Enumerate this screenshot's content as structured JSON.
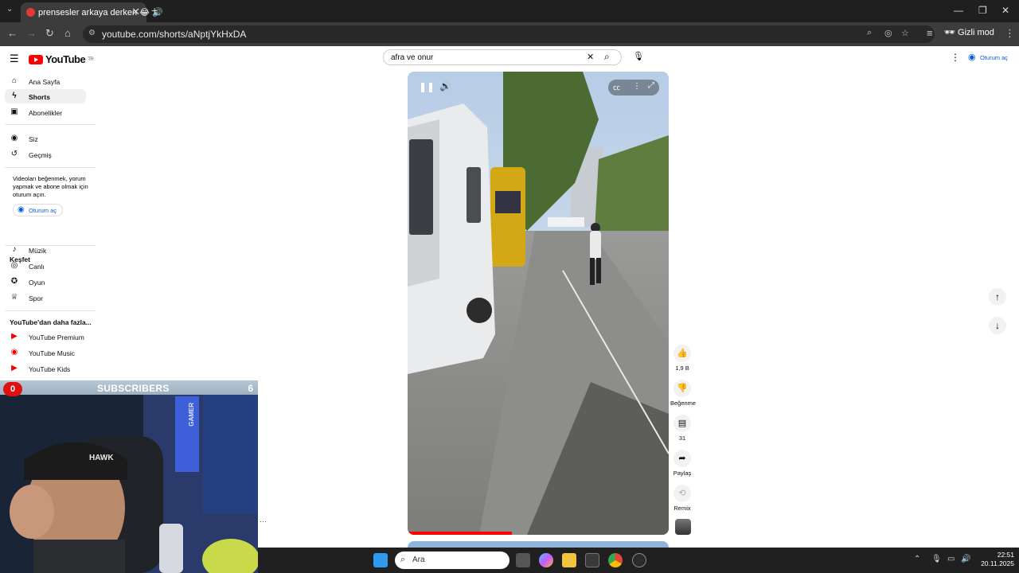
{
  "browser": {
    "tab_title": "prensesler arkaya derken 😂 🔊",
    "url": "youtube.com/shorts/aNptjYkHxDA",
    "incognito_label": "Gizli mod"
  },
  "youtube": {
    "logo_text": "YouTube",
    "region": "TR",
    "search_query": "afra ve onur",
    "top_signin": "Oturum aç",
    "sidebar": {
      "home": "Ana Sayfa",
      "shorts": "Shorts",
      "subscriptions": "Abonelikler",
      "you": "Siz",
      "history": "Geçmiş",
      "signin_note": "Videoları beğenmek, yorum yapmak ve abone olmak için oturum açın.",
      "signin_button": "Oturum aç",
      "explore_title": "Keşfet",
      "music": "Müzik",
      "live": "Canlı",
      "gaming": "Oyun",
      "sports": "Spor",
      "more_title": "YouTube'dan daha fazla...",
      "premium": "YouTube Premium",
      "ytmusic": "YouTube Music",
      "kids": "YouTube Kids"
    },
    "actions": {
      "likes": "1,9 B",
      "dislike": "Beğenme",
      "comments": "31",
      "share": "Paylaş",
      "remix": "Remix"
    },
    "progress": 0.4
  },
  "overlay": {
    "subscribers_label": "SUBSCRIBERS",
    "subscribers_left": "0",
    "subscribers_right": "6",
    "cap_text": "HAWK",
    "wall_text": "GAMER"
  },
  "taskbar": {
    "search_placeholder": "Ara",
    "time": "22:51",
    "date": "20.11.2025"
  },
  "colors": {
    "yt_red": "#ff0000",
    "link_blue": "#065fd4"
  }
}
